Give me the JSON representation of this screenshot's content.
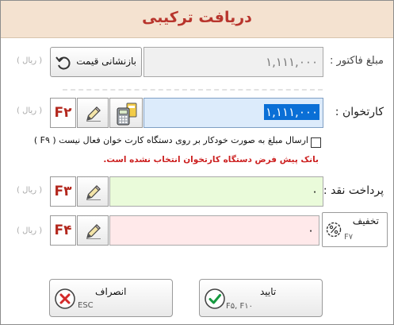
{
  "window": {
    "title": "دریافت ترکیبی"
  },
  "invoice": {
    "label": "مبلغ فاکتور :",
    "value": "۱,۱۱۱,۰۰۰",
    "unit": "( ریال )",
    "reset_label": "بازنشانی قیمت"
  },
  "card": {
    "label": "کارتخوان :",
    "value": "۱,۱۱۱,۰۰۰",
    "unit": "( ریال )",
    "fkey": "F۲",
    "checkbox_label": "ارسال مبلغ به صورت خودکار بر روی دستگاه کارت خوان فعال نیست ( F۹ )",
    "checkbox_checked": false,
    "warning": "بانک پیش فرض دستگاه کارتخوان انتخاب نشده است."
  },
  "cash": {
    "label": "پرداخت نقد :",
    "value": "۰",
    "unit": "( ریال )",
    "fkey": "F۳"
  },
  "discount": {
    "value": "۰",
    "unit": "( ریال )",
    "fkey": "F۴",
    "label": "تخفیف",
    "key": "F۷"
  },
  "actions": {
    "confirm_label": "تایید",
    "confirm_keys": "F۵, F۱۰",
    "cancel_label": "انصراف",
    "cancel_key": "ESC"
  },
  "colors": {
    "card_field": "#dcebfb",
    "card_selection": "#0a6fd6",
    "cash_field": "#eafbda",
    "discount_field": "#ffe9ea",
    "fkey_text": "#b3271d",
    "warning_text": "#cc1f1f"
  },
  "icons": [
    "undo-icon",
    "card-reader-icon",
    "pencil-icon",
    "percent-icon",
    "check-circle-icon",
    "cancel-circle-icon"
  ]
}
